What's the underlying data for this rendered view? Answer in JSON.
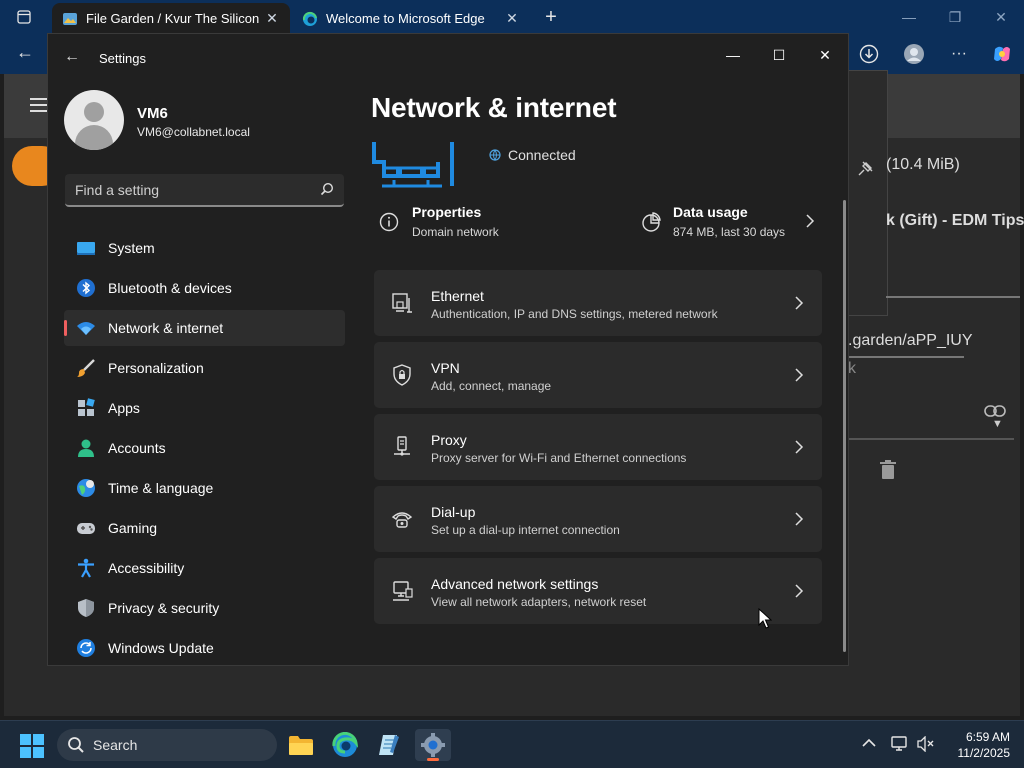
{
  "browser": {
    "tabs": [
      {
        "title": "File Garden / Kvur The Silicon"
      },
      {
        "title": "Welcome to Microsoft Edge"
      }
    ],
    "page": {
      "size_text": "(10.4 MiB)",
      "file_title": "k (Gift) - EDM Tips",
      "url_text": ".garden/aPP_IUY",
      "link_text": "k"
    }
  },
  "settings": {
    "window_title": "Settings",
    "user": {
      "name": "VM6",
      "email": "VM6@collabnet.local"
    },
    "search": {
      "placeholder": "Find a setting"
    },
    "nav": [
      {
        "label": "System"
      },
      {
        "label": "Bluetooth & devices"
      },
      {
        "label": "Network & internet"
      },
      {
        "label": "Personalization"
      },
      {
        "label": "Apps"
      },
      {
        "label": "Accounts"
      },
      {
        "label": "Time & language"
      },
      {
        "label": "Gaming"
      },
      {
        "label": "Accessibility"
      },
      {
        "label": "Privacy & security"
      },
      {
        "label": "Windows Update"
      }
    ],
    "selected_nav": "Network & internet",
    "page_title": "Network & internet",
    "status": "Connected",
    "properties": {
      "title": "Properties",
      "subtitle": "Domain network"
    },
    "data_usage": {
      "title": "Data usage",
      "subtitle": "874 MB, last 30 days"
    },
    "cards": [
      {
        "title": "Ethernet",
        "subtitle": "Authentication, IP and DNS settings, metered network"
      },
      {
        "title": "VPN",
        "subtitle": "Add, connect, manage"
      },
      {
        "title": "Proxy",
        "subtitle": "Proxy server for Wi-Fi and Ethernet connections"
      },
      {
        "title": "Dial-up",
        "subtitle": "Set up a dial-up internet connection"
      },
      {
        "title": "Advanced network settings",
        "subtitle": "View all network adapters, network reset"
      }
    ]
  },
  "taskbar": {
    "search_label": "Search",
    "time": "6:59 AM",
    "date": "11/2/2025"
  },
  "colors": {
    "accent": "#0078d4",
    "selected_indicator": "#ef5f5f",
    "settings_bg": "#202020",
    "card_bg": "#2b2b2b"
  }
}
